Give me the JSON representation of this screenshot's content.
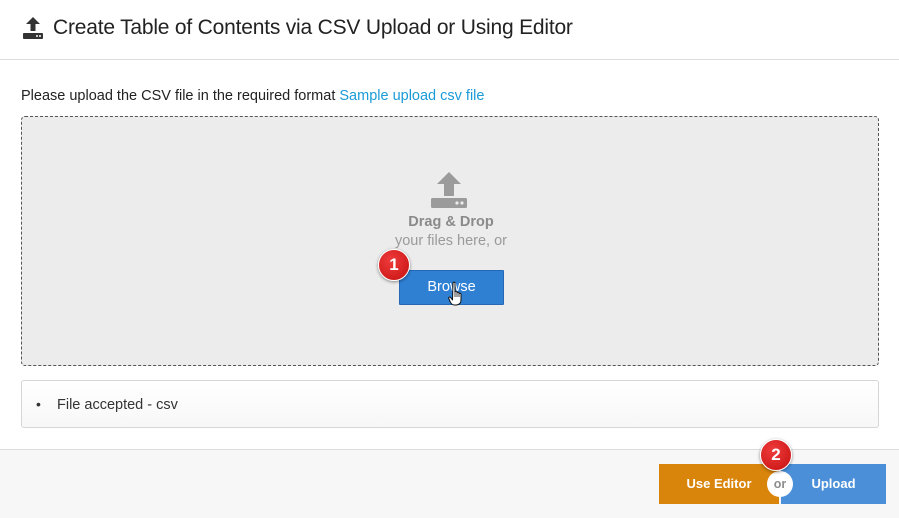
{
  "header": {
    "title": "Create Table of Contents via CSV Upload or Using Editor",
    "icon": "upload-tray-icon"
  },
  "intro": {
    "text": "Please upload the CSV file in the required format ",
    "link_label": "Sample upload csv file"
  },
  "dropzone": {
    "icon": "upload-tray-icon",
    "title": "Drag & Drop",
    "subtitle": "your files here, or",
    "browse_label": "Browse"
  },
  "accepted": {
    "bullet": "•",
    "text": "File accepted - csv"
  },
  "annotations": {
    "badge_1": "1",
    "badge_2": "2"
  },
  "footer": {
    "use_editor_label": "Use Editor",
    "or_label": "or",
    "upload_label": "Upload"
  },
  "colors": {
    "link": "#1a9bd7",
    "browse": "#2f7fd3",
    "use_editor": "#d9840a",
    "upload": "#4a8fd8",
    "badge": "#d21d1d"
  }
}
